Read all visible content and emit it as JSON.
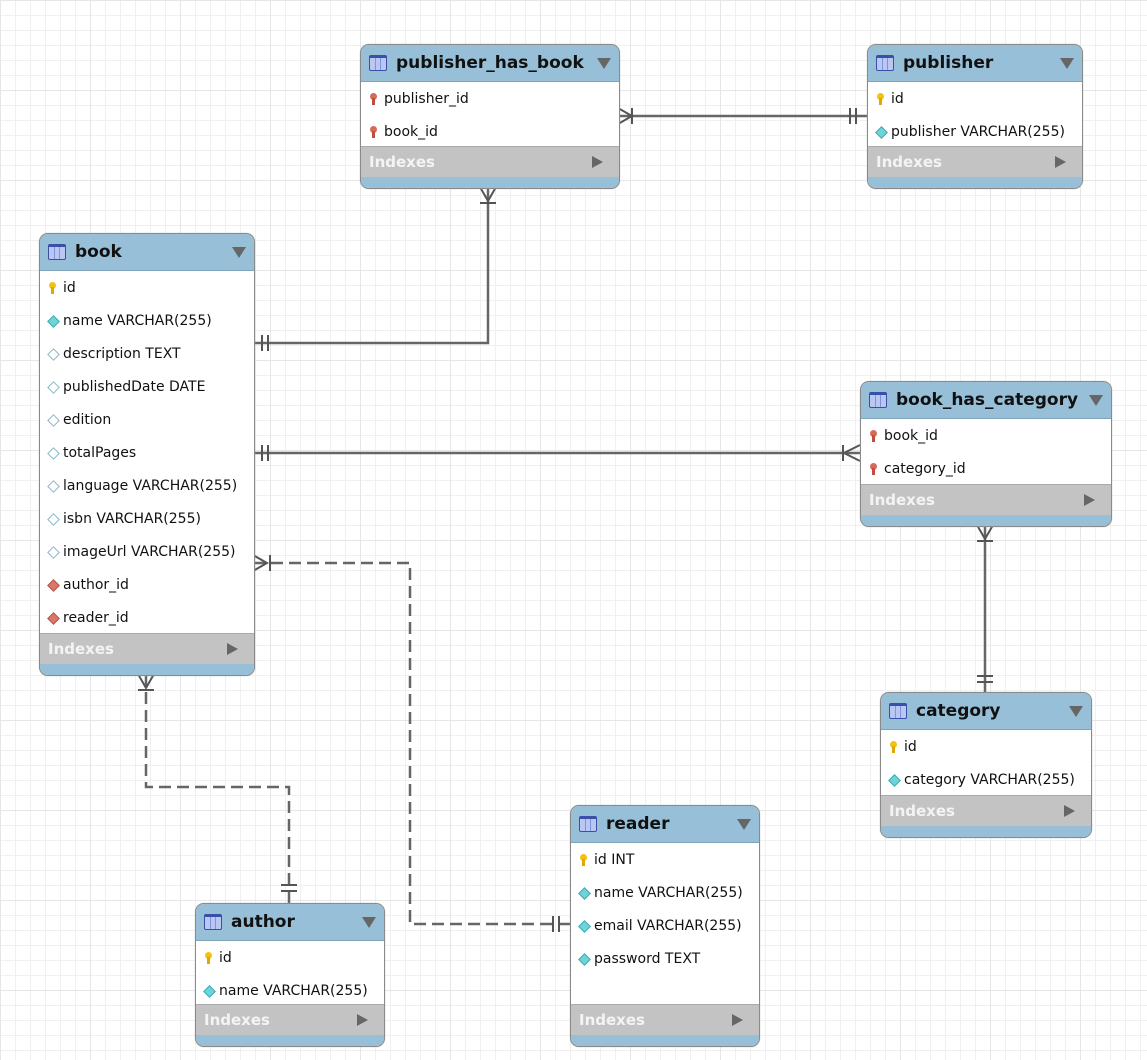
{
  "diagram": {
    "colors": {
      "header": "#97bfd8",
      "indexes": "#c3c3c3",
      "line": "#666666"
    },
    "tables": [
      {
        "id": "publisher_has_book",
        "name": "publisher_has_book",
        "indexes": "Indexes",
        "columns": [
          {
            "name": "publisher_id",
            "icon": "fk-key-icon"
          },
          {
            "name": "book_id",
            "icon": "fk-key-icon"
          }
        ]
      },
      {
        "id": "publisher",
        "name": "publisher",
        "indexes": "Indexes",
        "columns": [
          {
            "name": "id",
            "icon": "primary-key-icon"
          },
          {
            "name": "publisher VARCHAR(255)",
            "icon": "not-null-diamond-icon"
          }
        ]
      },
      {
        "id": "book",
        "name": "book",
        "indexes": "Indexes",
        "columns": [
          {
            "name": "id",
            "icon": "primary-key-icon"
          },
          {
            "name": "name VARCHAR(255)",
            "icon": "not-null-diamond-icon"
          },
          {
            "name": "description TEXT",
            "icon": "nullable-diamond-icon"
          },
          {
            "name": "publishedDate DATE",
            "icon": "nullable-diamond-icon"
          },
          {
            "name": "edition",
            "icon": "nullable-diamond-icon"
          },
          {
            "name": "totalPages",
            "icon": "nullable-diamond-icon"
          },
          {
            "name": "language VARCHAR(255)",
            "icon": "nullable-diamond-icon"
          },
          {
            "name": "isbn VARCHAR(255)",
            "icon": "nullable-diamond-icon"
          },
          {
            "name": "imageUrl VARCHAR(255)",
            "icon": "nullable-diamond-icon"
          },
          {
            "name": "author_id",
            "icon": "foreign-key-diamond-icon"
          },
          {
            "name": "reader_id",
            "icon": "foreign-key-diamond-icon"
          }
        ]
      },
      {
        "id": "book_has_category",
        "name": "book_has_category",
        "indexes": "Indexes",
        "columns": [
          {
            "name": "book_id",
            "icon": "fk-key-icon"
          },
          {
            "name": "category_id",
            "icon": "fk-key-icon"
          }
        ]
      },
      {
        "id": "category",
        "name": "category",
        "indexes": "Indexes",
        "columns": [
          {
            "name": "id",
            "icon": "primary-key-icon"
          },
          {
            "name": "category VARCHAR(255)",
            "icon": "not-null-diamond-icon"
          }
        ]
      },
      {
        "id": "reader",
        "name": "reader",
        "indexes": "Indexes",
        "columns": [
          {
            "name": "id INT",
            "icon": "primary-key-icon"
          },
          {
            "name": "name VARCHAR(255)",
            "icon": "not-null-diamond-icon"
          },
          {
            "name": "email VARCHAR(255)",
            "icon": "not-null-diamond-icon"
          },
          {
            "name": "password TEXT",
            "icon": "not-null-diamond-icon"
          }
        ]
      },
      {
        "id": "author",
        "name": "author",
        "indexes": "Indexes",
        "columns": [
          {
            "name": "id",
            "icon": "primary-key-icon"
          },
          {
            "name": "name VARCHAR(255)",
            "icon": "not-null-diamond-icon"
          }
        ]
      }
    ],
    "relationships": [
      {
        "from": "publisher_has_book",
        "to": "publisher",
        "from_card": "many",
        "to_card": "one",
        "style": "identifying"
      },
      {
        "from": "publisher_has_book",
        "to": "book",
        "from_card": "many",
        "to_card": "one",
        "style": "identifying"
      },
      {
        "from": "book_has_category",
        "to": "book",
        "from_card": "many",
        "to_card": "one",
        "style": "identifying"
      },
      {
        "from": "book_has_category",
        "to": "category",
        "from_card": "many",
        "to_card": "one",
        "style": "identifying"
      },
      {
        "from": "book",
        "to": "reader",
        "from_card": "many",
        "to_card": "one",
        "style": "non-identifying"
      },
      {
        "from": "book",
        "to": "author",
        "from_card": "many",
        "to_card": "one",
        "style": "non-identifying"
      }
    ]
  }
}
